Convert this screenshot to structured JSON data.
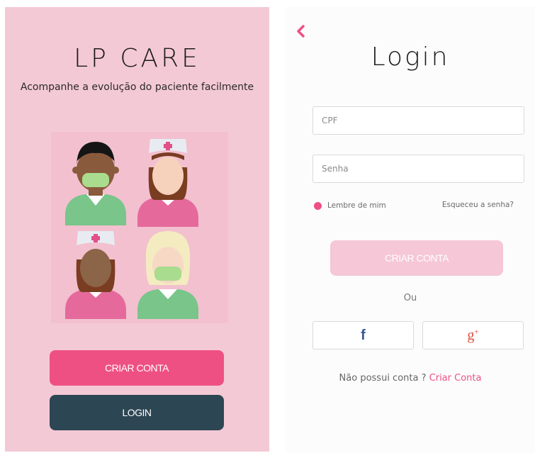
{
  "splash": {
    "brand": "LP CARE",
    "tagline": "Acompanhe a evolução do paciente facilmente",
    "criar_conta_label": "CRIAR CONTA",
    "login_label": "LOGIN"
  },
  "login": {
    "title": "Login",
    "cpf_placeholder": "CPF",
    "senha_placeholder": "Senha",
    "remember_label": "Lembre de mim",
    "forgot_label": "Esqueceu a senha?",
    "criar_conta_label": "CRIAR CONTA",
    "or_label": "Ou",
    "facebook_glyph": "f",
    "google_glyph": "g",
    "google_plus": "+",
    "no_account_text": "Não possui conta ? ",
    "signup_link": "Criar Conta"
  },
  "colors": {
    "panel_pink": "#f4c9d6",
    "accent_pink": "#ee5084",
    "dark_button": "#2d4653",
    "light_pink_button": "#f6c7d6"
  },
  "icons": {
    "back": "chevron-left-icon",
    "facebook": "facebook-icon",
    "google_plus": "google-plus-icon"
  }
}
